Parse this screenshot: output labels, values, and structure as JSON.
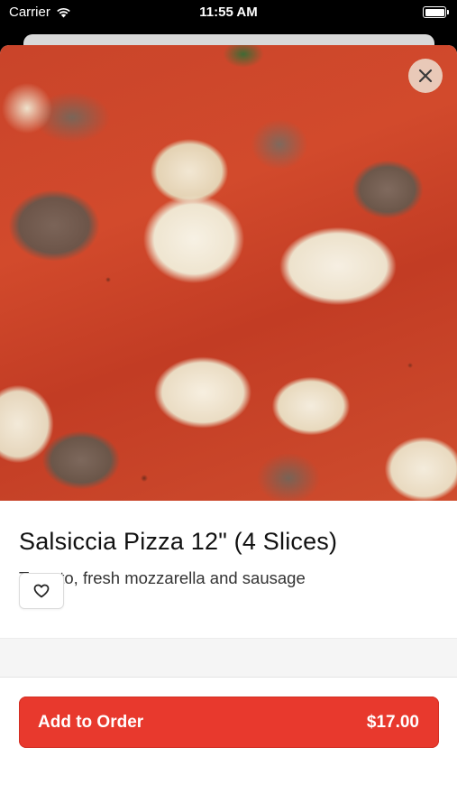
{
  "status_bar": {
    "carrier": "Carrier",
    "time": "11:55 AM"
  },
  "item": {
    "title": "Salsiccia Pizza 12\" (4 Slices)",
    "description": "Tomato, fresh mozzarella and sausage",
    "image": "pizza-photo"
  },
  "actions": {
    "add_label": "Add to Order",
    "price": "$17.00"
  },
  "icons": {
    "close": "close-icon",
    "favorite": "heart-icon",
    "wifi": "wifi-icon",
    "battery": "battery-icon"
  },
  "colors": {
    "accent": "#e8392d",
    "close_bg": "#ebd7c8"
  }
}
